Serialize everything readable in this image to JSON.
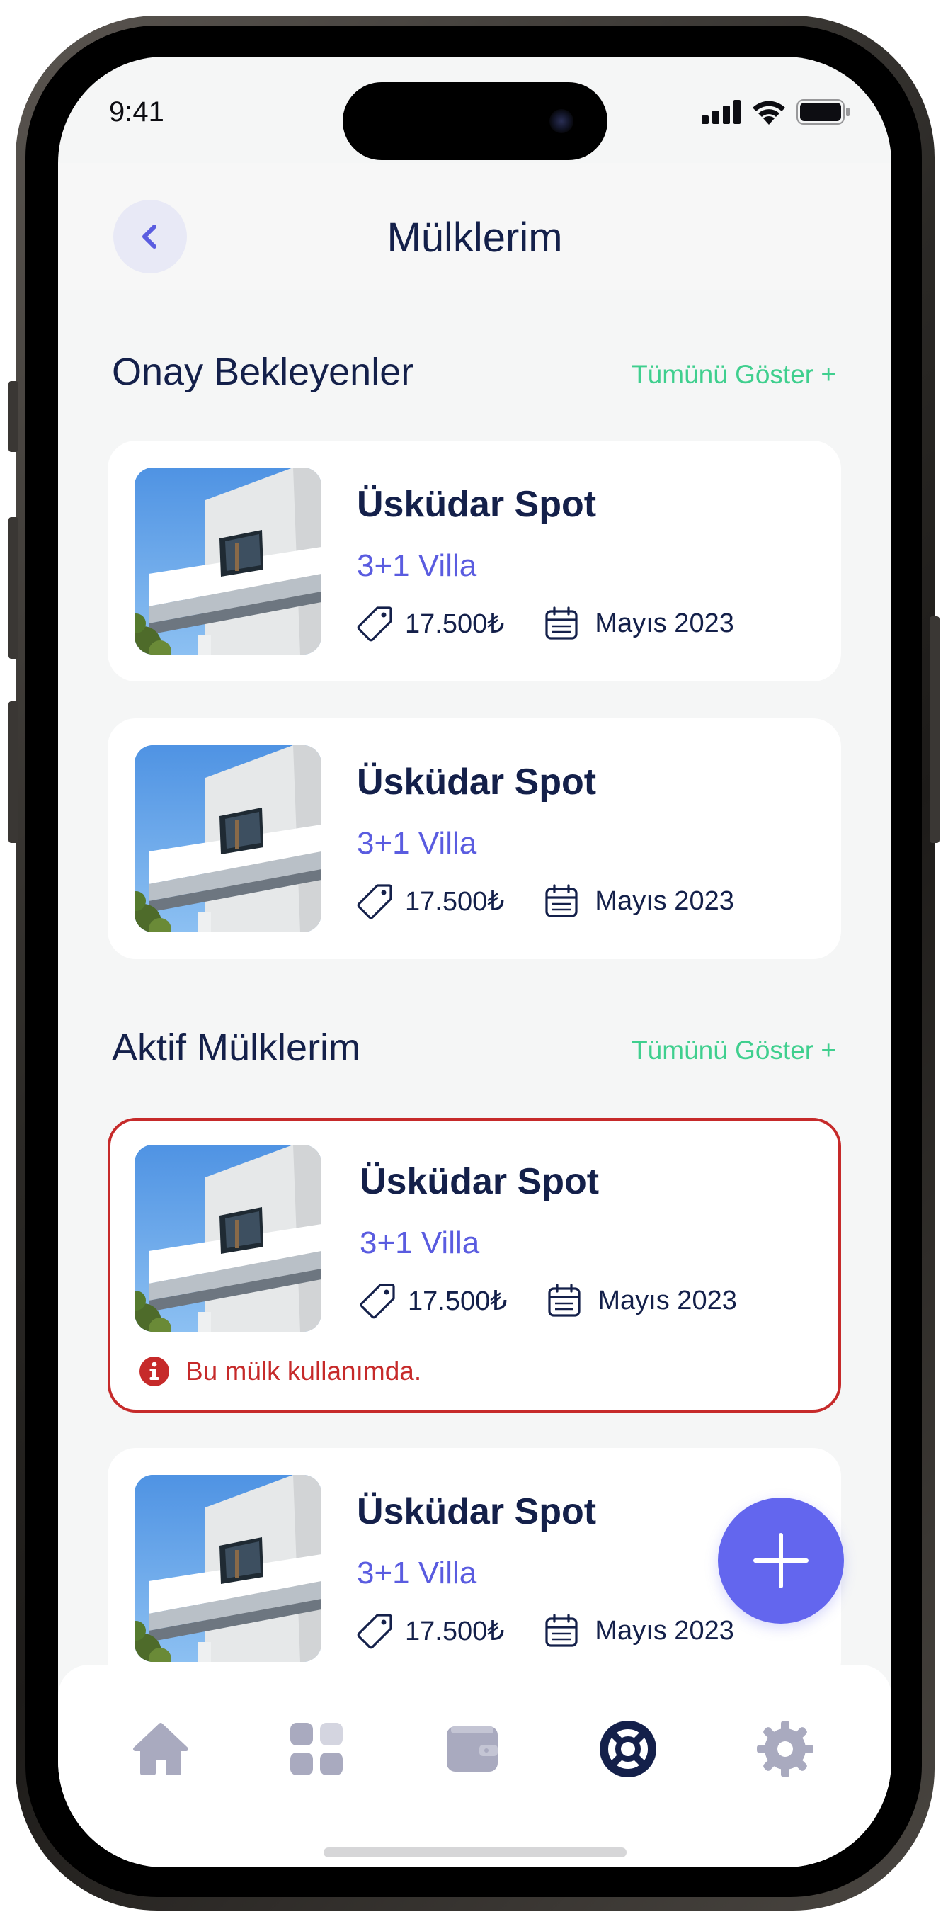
{
  "status_bar": {
    "time": "9:41"
  },
  "header": {
    "title": "Mülklerim"
  },
  "sections": {
    "pending": {
      "title": "Onay Bekleyenler",
      "show_all": "Tümünü Göster +"
    },
    "active": {
      "title": "Aktif Mülklerim",
      "show_all": "Tümünü Göster +"
    }
  },
  "cards": [
    {
      "title": "Üsküdar Spot",
      "type": "3+1 Villa",
      "price": "17.500₺",
      "date": "Mayıs 2023"
    },
    {
      "title": "Üsküdar Spot",
      "type": "3+1 Villa",
      "price": "17.500₺",
      "date": "Mayıs 2023"
    },
    {
      "title": "Üsküdar Spot",
      "type": "3+1 Villa",
      "price": "17.500₺",
      "date": "Mayıs 2023",
      "warning": "Bu mülk kullanımda."
    },
    {
      "title": "Üsküdar Spot",
      "type": "3+1 Villa",
      "price": "17.500₺",
      "date": "Mayıs 2023"
    }
  ],
  "tabbar": {
    "items": [
      {
        "icon": "home-icon",
        "active": false
      },
      {
        "icon": "grid-icon",
        "active": false
      },
      {
        "icon": "wallet-icon",
        "active": false
      },
      {
        "icon": "lifebuoy-icon",
        "active": true
      },
      {
        "icon": "gear-icon",
        "active": false
      }
    ]
  },
  "colors": {
    "navy": "#14204a",
    "accent": "#5a5ce0",
    "fab": "#6366ee",
    "green": "#3fcf8e",
    "alert": "#c62a2a",
    "tab_inactive": "#a9aabf"
  }
}
